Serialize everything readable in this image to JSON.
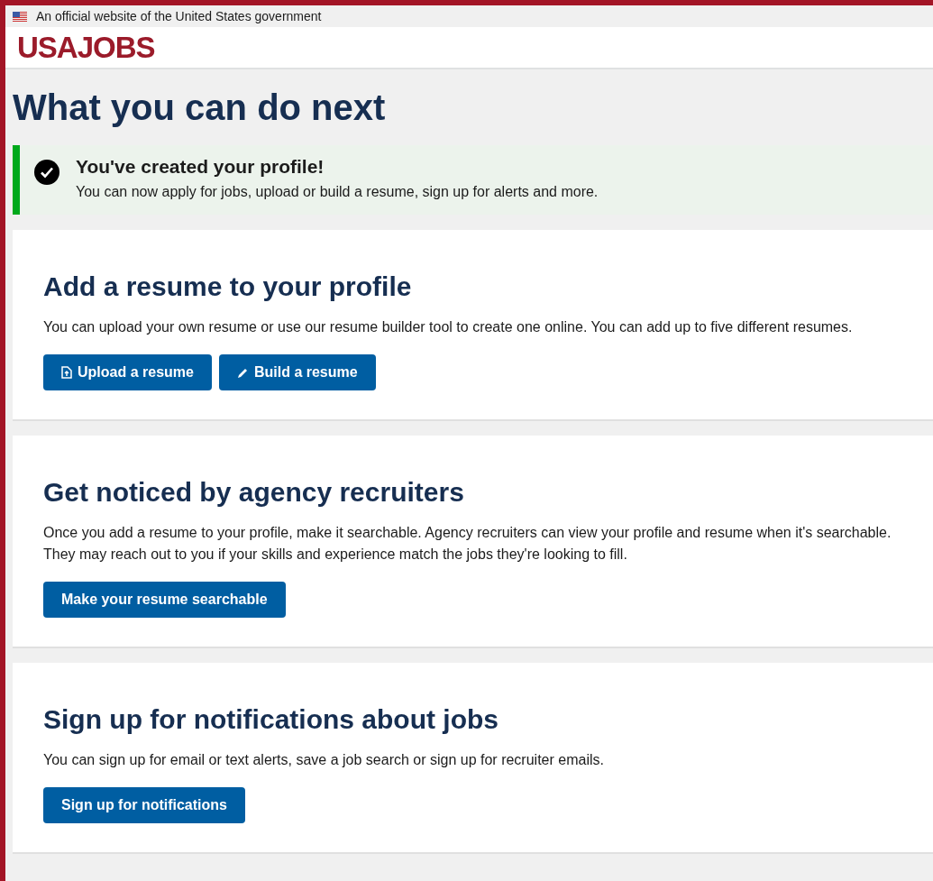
{
  "banner": {
    "text": "An official website of the United States government"
  },
  "header": {
    "logo": "USAJOBS"
  },
  "page_title": "What you can do next",
  "alert": {
    "kind": "success",
    "title": "You've created your profile!",
    "text": "You can now apply for jobs, upload or build a resume, sign up for alerts and more."
  },
  "cards": [
    {
      "title": "Add a resume to your profile",
      "text": "You can upload your own resume or use our resume builder tool to create one online. You can add up to five different resumes.",
      "buttons": [
        {
          "label": "Upload a resume",
          "kind": "upload"
        },
        {
          "label": "Build a resume",
          "kind": "edit"
        }
      ]
    },
    {
      "title": "Get noticed by agency recruiters",
      "text": "Once you add a resume to your profile, make it searchable. Agency recruiters can view your profile and resume when it's searchable. They may reach out to you if your skills and experience match the jobs they're looking to fill.",
      "buttons": [
        {
          "label": "Make your resume searchable",
          "kind": "plain"
        }
      ]
    },
    {
      "title": "Sign up for notifications about jobs",
      "text": "You can sign up for email or text alerts, save a job search or sign up for recruiter emails.",
      "buttons": [
        {
          "label": "Sign up for notifications",
          "kind": "plain"
        }
      ]
    }
  ]
}
